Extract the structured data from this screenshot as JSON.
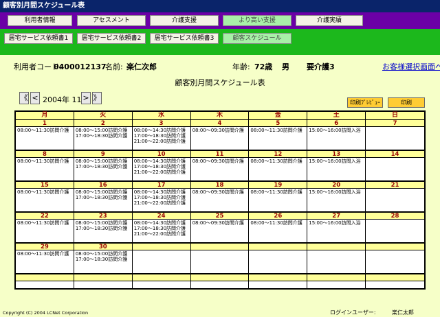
{
  "window_title": "顧客別月間スケジュール表",
  "menu_row1": [
    "利用者情報",
    "アセスメント",
    "介護支援",
    "より高い支援",
    "介護実績"
  ],
  "menu_row2": [
    "居宅サービス依頼書1",
    "居宅サービス依頼書2",
    "居宅サービス依頼書3",
    "顧客スケジュール"
  ],
  "user": {
    "code_label": "利用者コード:",
    "code": "0400012137",
    "name_label": "名前:",
    "name": "楽仁次郎",
    "age_label": "年齢:",
    "age": "72歳",
    "sex": "男",
    "care_level": "要介護3",
    "select_link": "お客様選択画面へ"
  },
  "page_caption": "顧客別月間スケジュール表",
  "nav": {
    "first": "《",
    "prev": "<",
    "month": "2004年 11月",
    "next": ">",
    "last": "》"
  },
  "toolbar": {
    "preview": "印刷ﾌﾟﾚﾋﾞｭｰ",
    "print": "印刷"
  },
  "weekdays": [
    "月",
    "火",
    "水",
    "木",
    "金",
    "土",
    "日"
  ],
  "weeks": [
    {
      "days": [
        "1",
        "2",
        "3",
        "4",
        "5",
        "6",
        "7"
      ],
      "events": [
        [
          "08:00～11:30訪問介護"
        ],
        [
          "08:00～15:00訪問介護",
          "17:00～18:30訪問介護"
        ],
        [
          "08:00～14:30訪問介護",
          "17:00～18:30訪問介護",
          "21:00～22:00訪問介護"
        ],
        [
          "08:00～09:30訪問介護"
        ],
        [
          "08:00～11:30訪問介護"
        ],
        [
          "15:00～16:00訪問入浴"
        ],
        []
      ]
    },
    {
      "days": [
        "8",
        "9",
        "10",
        "11",
        "12",
        "13",
        "14"
      ],
      "events": [
        [
          "08:00～11:30訪問介護"
        ],
        [
          "08:00～15:00訪問介護",
          "17:00～18:30訪問介護"
        ],
        [
          "08:00～14:30訪問介護",
          "17:00～18:30訪問介護",
          "21:00～22:00訪問介護"
        ],
        [
          "08:00～09:30訪問介護"
        ],
        [
          "08:00～11:30訪問介護"
        ],
        [
          "15:00～16:00訪問入浴"
        ],
        []
      ]
    },
    {
      "days": [
        "15",
        "16",
        "17",
        "18",
        "19",
        "20",
        "21"
      ],
      "events": [
        [
          "08:00～11:30訪問介護"
        ],
        [
          "08:00～15:00訪問介護",
          "17:00～18:30訪問介護"
        ],
        [
          "08:00～14:30訪問介護",
          "17:00～18:30訪問介護",
          "21:00～22:00訪問介護"
        ],
        [
          "08:00～09:30訪問介護"
        ],
        [
          "08:00～11:30訪問介護"
        ],
        [
          "15:00～16:00訪問入浴"
        ],
        []
      ]
    },
    {
      "days": [
        "22",
        "23",
        "24",
        "25",
        "26",
        "27",
        "28"
      ],
      "events": [
        [
          "08:00～11:30訪問介護"
        ],
        [
          "08:00～15:00訪問介護",
          "17:00～18:30訪問介護"
        ],
        [
          "08:00～14:30訪問介護",
          "17:00～18:30訪問介護",
          "21:00～22:00訪問介護"
        ],
        [
          "08:00～09:30訪問介護"
        ],
        [
          "08:00～11:30訪問介護"
        ],
        [
          "15:00～16:00訪問入浴"
        ],
        []
      ]
    },
    {
      "days": [
        "29",
        "30",
        "",
        "",
        "",
        "",
        ""
      ],
      "events": [
        [
          "08:00～11:30訪問介護"
        ],
        [
          "08:00～15:00訪問介護",
          "17:00～18:30訪問介護"
        ],
        [],
        [],
        [],
        [],
        []
      ]
    },
    {
      "days": [
        "",
        "",
        "",
        "",
        "",
        "",
        ""
      ],
      "events": [
        [],
        [],
        [],
        [],
        [],
        [],
        []
      ]
    }
  ],
  "footer": {
    "copyright": "Copyright (C) 2004 LCNet Corporation",
    "login_label": "ログインユーザー:",
    "login_user": "楽仁太郎"
  }
}
